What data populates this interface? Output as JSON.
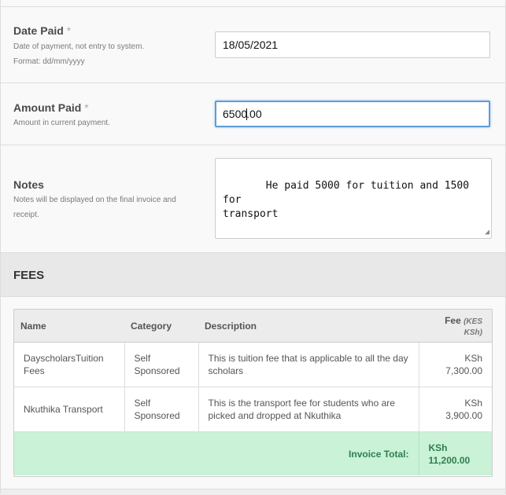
{
  "date_paid": {
    "label": "Date Paid",
    "required_mark": "*",
    "help_line1": "Date of payment, not entry to system.",
    "help_line2": "Format: dd/mm/yyyy",
    "value": "18/05/2021"
  },
  "amount_paid": {
    "label": "Amount Paid",
    "required_mark": "*",
    "help": "Amount in current payment.",
    "value_before_caret": "6500",
    "value_after_caret": ".00"
  },
  "notes": {
    "label": "Notes",
    "help": "Notes will be displayed on the final invoice and receipt.",
    "value": " He paid 5000 for tuition and 1500 for\ntransport"
  },
  "fees": {
    "title": "FEES",
    "columns": {
      "name": "Name",
      "category": "Category",
      "description": "Description",
      "fee": "Fee",
      "fee_unit": "(KES KSh)"
    },
    "rows": [
      {
        "name": "DayscholarsTuition Fees",
        "category": "Self Sponsored",
        "description": "This is tuition fee that is applicable to all the day scholars",
        "fee": "KSh 7,300.00"
      },
      {
        "name": "Nkuthika Transport",
        "category": "Self Sponsored",
        "description": "This is the transport fee for students who are picked and dropped at Nkuthika",
        "fee": "KSh 3,900.00"
      }
    ],
    "total_label": "Invoice Total:",
    "total_value": "KSh 11,200.00"
  },
  "colors": {
    "focus_border": "#5b9dd9",
    "total_bg": "#c9f2d6",
    "total_text": "#2e7d4f"
  },
  "icons": [
    "resize-grip-icon"
  ]
}
